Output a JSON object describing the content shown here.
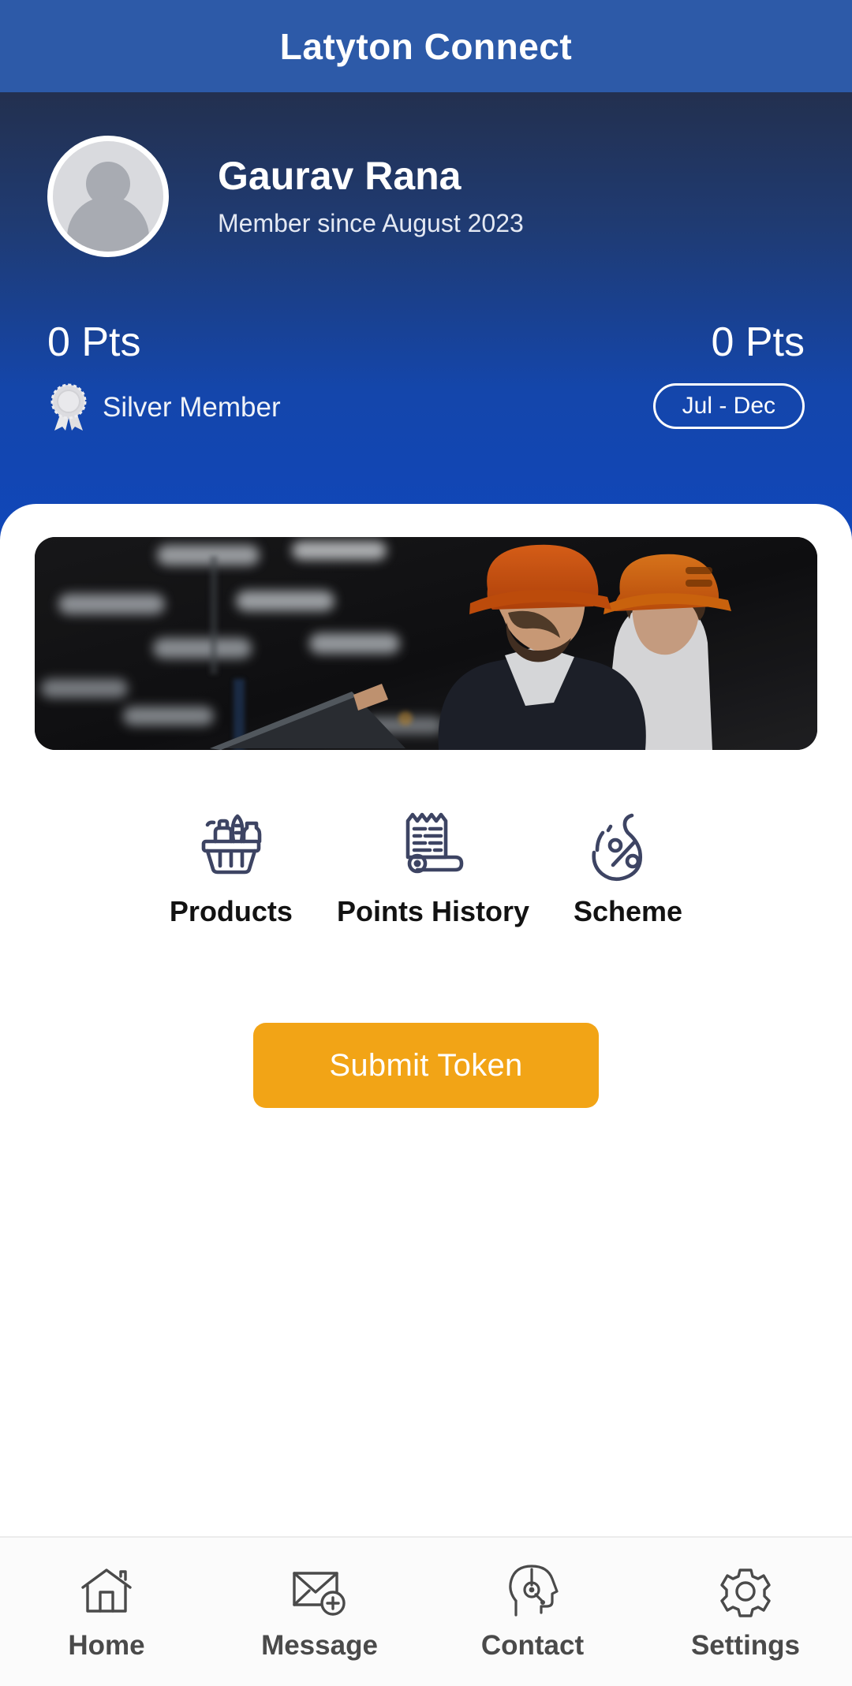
{
  "titlebar": {
    "app_title": "Latyton Connect",
    "background_color": "#2D5AA8"
  },
  "profile": {
    "name": "Gaurav Rana",
    "member_since": "Member since August 2023",
    "avatar_icon": "user-avatar-placeholder-icon"
  },
  "points": {
    "left": {
      "value": "0 Pts",
      "tier_label": "Silver Member",
      "tier_icon": "silver-medal-icon"
    },
    "right": {
      "value": "0 Pts",
      "period_chip": "Jul - Dec"
    }
  },
  "banner": {
    "alt_description": "Two industrial workers wearing orange hard hats reviewing a laptop in a dark warehouse"
  },
  "actions": [
    {
      "label": "Products",
      "icon": "shopping-basket-icon"
    },
    {
      "label": "Points History",
      "icon": "receipt-scroll-icon"
    },
    {
      "label": "Scheme",
      "icon": "flame-percent-icon"
    }
  ],
  "submit": {
    "label": "Submit Token",
    "color": "#F2A416"
  },
  "bottom_nav": [
    {
      "label": "Home",
      "icon": "home-icon"
    },
    {
      "label": "Message",
      "icon": "envelope-plus-icon"
    },
    {
      "label": "Contact",
      "icon": "headset-support-icon"
    },
    {
      "label": "Settings",
      "icon": "gear-icon"
    }
  ]
}
